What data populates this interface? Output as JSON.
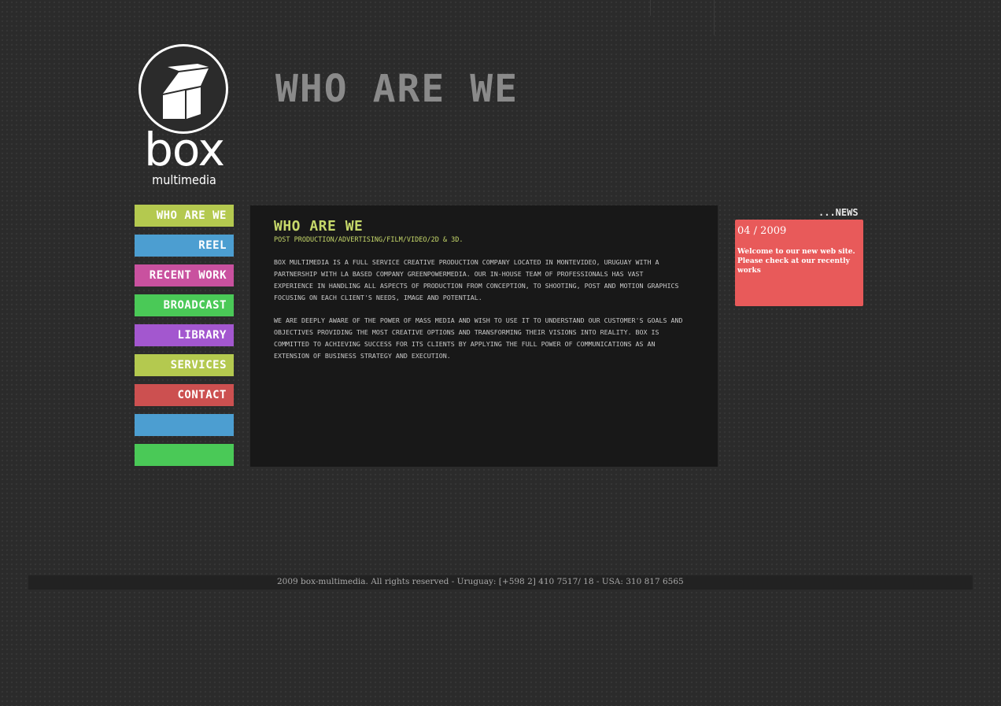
{
  "colors": {
    "green_nav": "#b4c94f",
    "blue_nav": "#4c9ed1",
    "pink_nav": "#c9519f",
    "bright_green_nav": "#4ac957",
    "purple_nav": "#a357cf",
    "red_nav": "#cc5050",
    "heading_accent": "#c6d86a",
    "news_box": "#e85a5a"
  },
  "logo": {
    "icon": "cube-icon",
    "word": "box",
    "sub": "multimedia"
  },
  "page_title": "WHO ARE WE",
  "nav": [
    {
      "label": "WHO ARE WE",
      "color": "#b4c94f"
    },
    {
      "label": "REEL",
      "color": "#4c9ed1"
    },
    {
      "label": "RECENT WORK",
      "color": "#c9519f"
    },
    {
      "label": "BROADCAST",
      "color": "#4ac957"
    },
    {
      "label": "LIBRARY",
      "color": "#a357cf"
    },
    {
      "label": "SERVICES",
      "color": "#b4c94f"
    },
    {
      "label": "CONTACT",
      "color": "#cc5050"
    },
    {
      "label": "",
      "color": "#4c9ed1"
    },
    {
      "label": "",
      "color": "#4ac957"
    }
  ],
  "main": {
    "heading": "WHO ARE WE",
    "subheading": "POST PRODUCTION/ADVERTISING/FILM/VIDEO/2D & 3D.",
    "paragraphs": [
      "BOX MULTIMEDIA IS A FULL SERVICE CREATIVE PRODUCTION COMPANY LOCATED IN MONTEVIDEO, URUGUAY WITH A PARTNERSHIP WITH LA BASED COMPANY GREENPOWERMEDIA. OUR IN-HOUSE TEAM OF PROFESSIONALS HAS VAST EXPERIENCE IN HANDLING ALL ASPECTS OF PRODUCTION FROM CONCEPTION, TO SHOOTING, POST AND MOTION GRAPHICS FOCUSING ON EACH CLIENT'S NEEDS, IMAGE AND POTENTIAL.",
      "WE ARE DEEPLY AWARE OF THE POWER OF MASS MEDIA AND WISH TO USE IT TO UNDERSTAND OUR CUSTOMER'S GOALS AND OBJECTIVES PROVIDING THE MOST CREATIVE OPTIONS AND TRANSFORMING THEIR VISIONS INTO REALITY. BOX IS COMMITTED TO ACHIEVING SUCCESS FOR ITS CLIENTS BY APPLYING THE FULL POWER OF COMMUNICATIONS AS AN EXTENSION OF BUSINESS STRATEGY AND EXECUTION."
    ]
  },
  "news": {
    "label": "...NEWS",
    "date": "04 / 2009",
    "text": "Welcome to our new web site. Please check at our recently works"
  },
  "footer": {
    "text": "2009 box-multimedia. All rights reserved - Uruguay: [+598 2] 410 7517/ 18  -  USA: 310 817 6565"
  }
}
